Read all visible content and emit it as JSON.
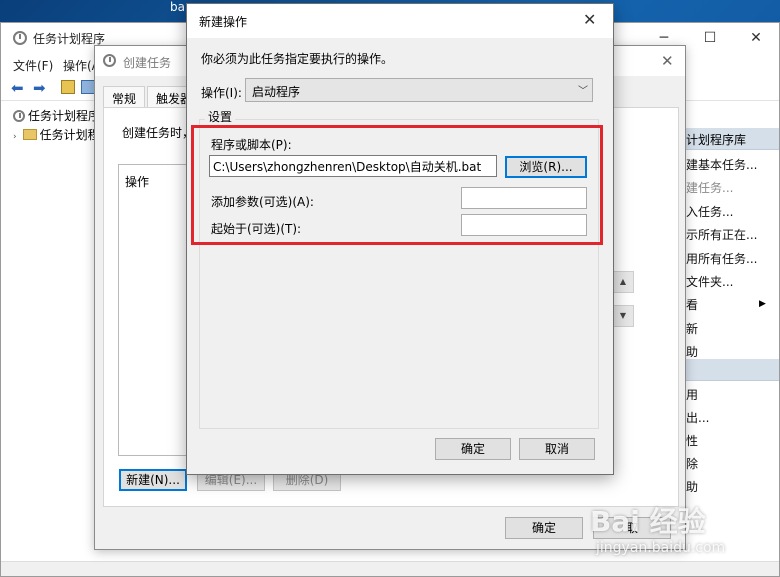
{
  "desktop": {
    "top_fragment": "ba"
  },
  "main_window": {
    "title": "任务计划程序",
    "menu": [
      "文件(F)",
      "操作(A)"
    ],
    "tree": {
      "root": "任务计划程序",
      "child": "任务计划程"
    },
    "actions_pane": {
      "header": "计划程序库",
      "items": [
        {
          "label": "建基本任务...",
          "disabled": false
        },
        {
          "label": "建任务...",
          "disabled": true
        },
        {
          "label": "入任务...",
          "disabled": false
        },
        {
          "label": "示所有正在...",
          "disabled": false
        },
        {
          "label": "用所有任务...",
          "disabled": false
        },
        {
          "label": "文件夹...",
          "disabled": false
        },
        {
          "label": "看",
          "disabled": false,
          "submenu": true
        },
        {
          "label": "新",
          "disabled": false
        },
        {
          "label": "助",
          "disabled": false
        }
      ],
      "items2": [
        "用",
        "出...",
        "性",
        "除",
        "助"
      ]
    }
  },
  "create_task": {
    "title": "创建任务",
    "tabs": [
      "常规",
      "触发器"
    ],
    "description": "创建任务时，",
    "list_header": "操作",
    "buttons": {
      "new": "新建(N)...",
      "edit": "编辑(E)...",
      "delete": "删除(D)",
      "ok": "确定",
      "cancel": "取"
    }
  },
  "new_action": {
    "title": "新建操作",
    "instruction": "你必须为此任务指定要执行的操作。",
    "action_label": "操作(I):",
    "action_value": "启动程序",
    "settings_label": "设置",
    "program_label": "程序或脚本(P):",
    "program_value": "C:\\Users\\zhongzhenren\\Desktop\\自动关机.bat",
    "browse_button": "浏览(R)...",
    "args_label": "添加参数(可选)(A):",
    "args_value": "",
    "start_in_label": "起始于(可选)(T):",
    "start_in_value": "",
    "ok_button": "确定",
    "cancel_button": "取消"
  },
  "watermark": {
    "logo": "Bai 经验",
    "url": "jingyan.baidu.com"
  },
  "colors": {
    "highlight": "#e0262c",
    "focus": "#0078d7",
    "pane_header": "#d5dfea"
  }
}
